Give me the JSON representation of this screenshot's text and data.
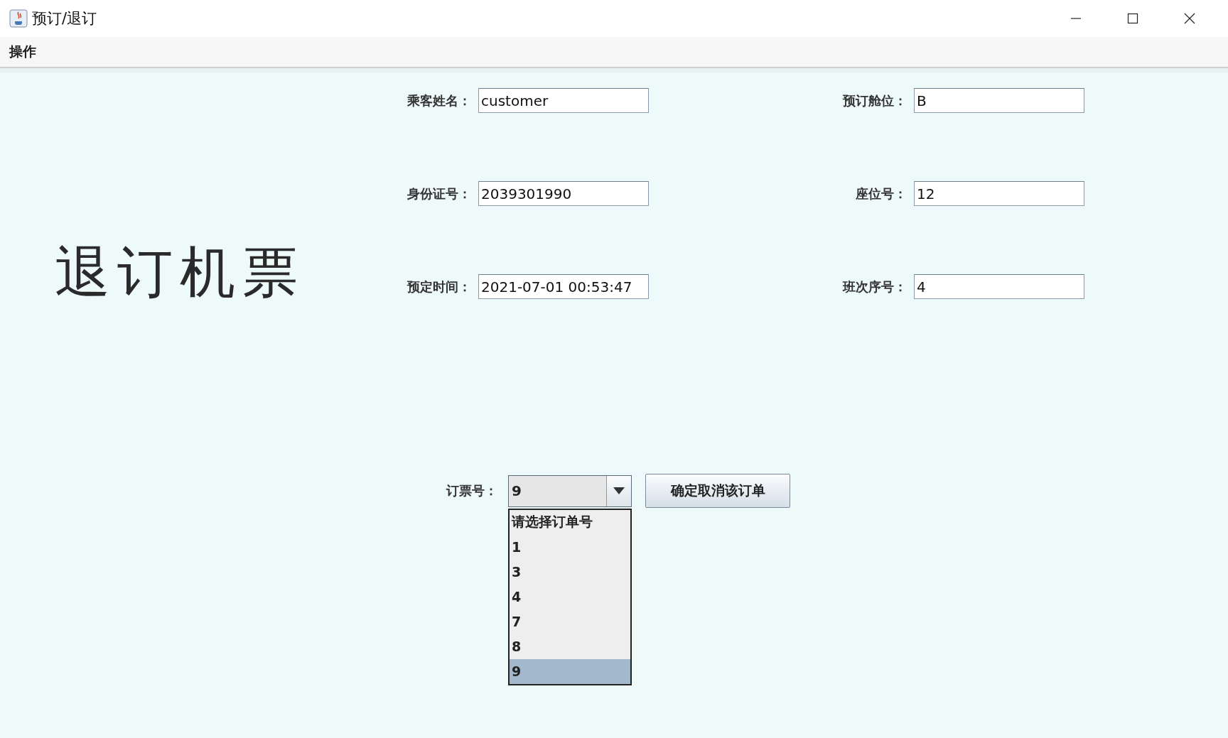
{
  "window": {
    "title": "预订/退订"
  },
  "menu": [
    {
      "label": "操作"
    }
  ],
  "heading": "退订机票",
  "fields": [
    {
      "label": "乘客姓名：",
      "value": "customer"
    },
    {
      "label": "预订舱位：",
      "value": "B"
    },
    {
      "label": "身份证号：",
      "value": "2039301990"
    },
    {
      "label": "座位号：",
      "value": "12"
    },
    {
      "label": "预定时间：",
      "value": "2021-07-01 00:53:47"
    },
    {
      "label": "班次序号：",
      "value": "4"
    }
  ],
  "order": {
    "label": "订票号：",
    "value": "9",
    "expanded": true,
    "options": [
      {
        "label": "请选择订单号",
        "selected": false
      },
      {
        "label": "1",
        "selected": false
      },
      {
        "label": "3",
        "selected": false
      },
      {
        "label": "4",
        "selected": false
      },
      {
        "label": "7",
        "selected": false
      },
      {
        "label": "8",
        "selected": false
      },
      {
        "label": "9",
        "selected": true
      }
    ]
  },
  "button": "确定取消该订单"
}
